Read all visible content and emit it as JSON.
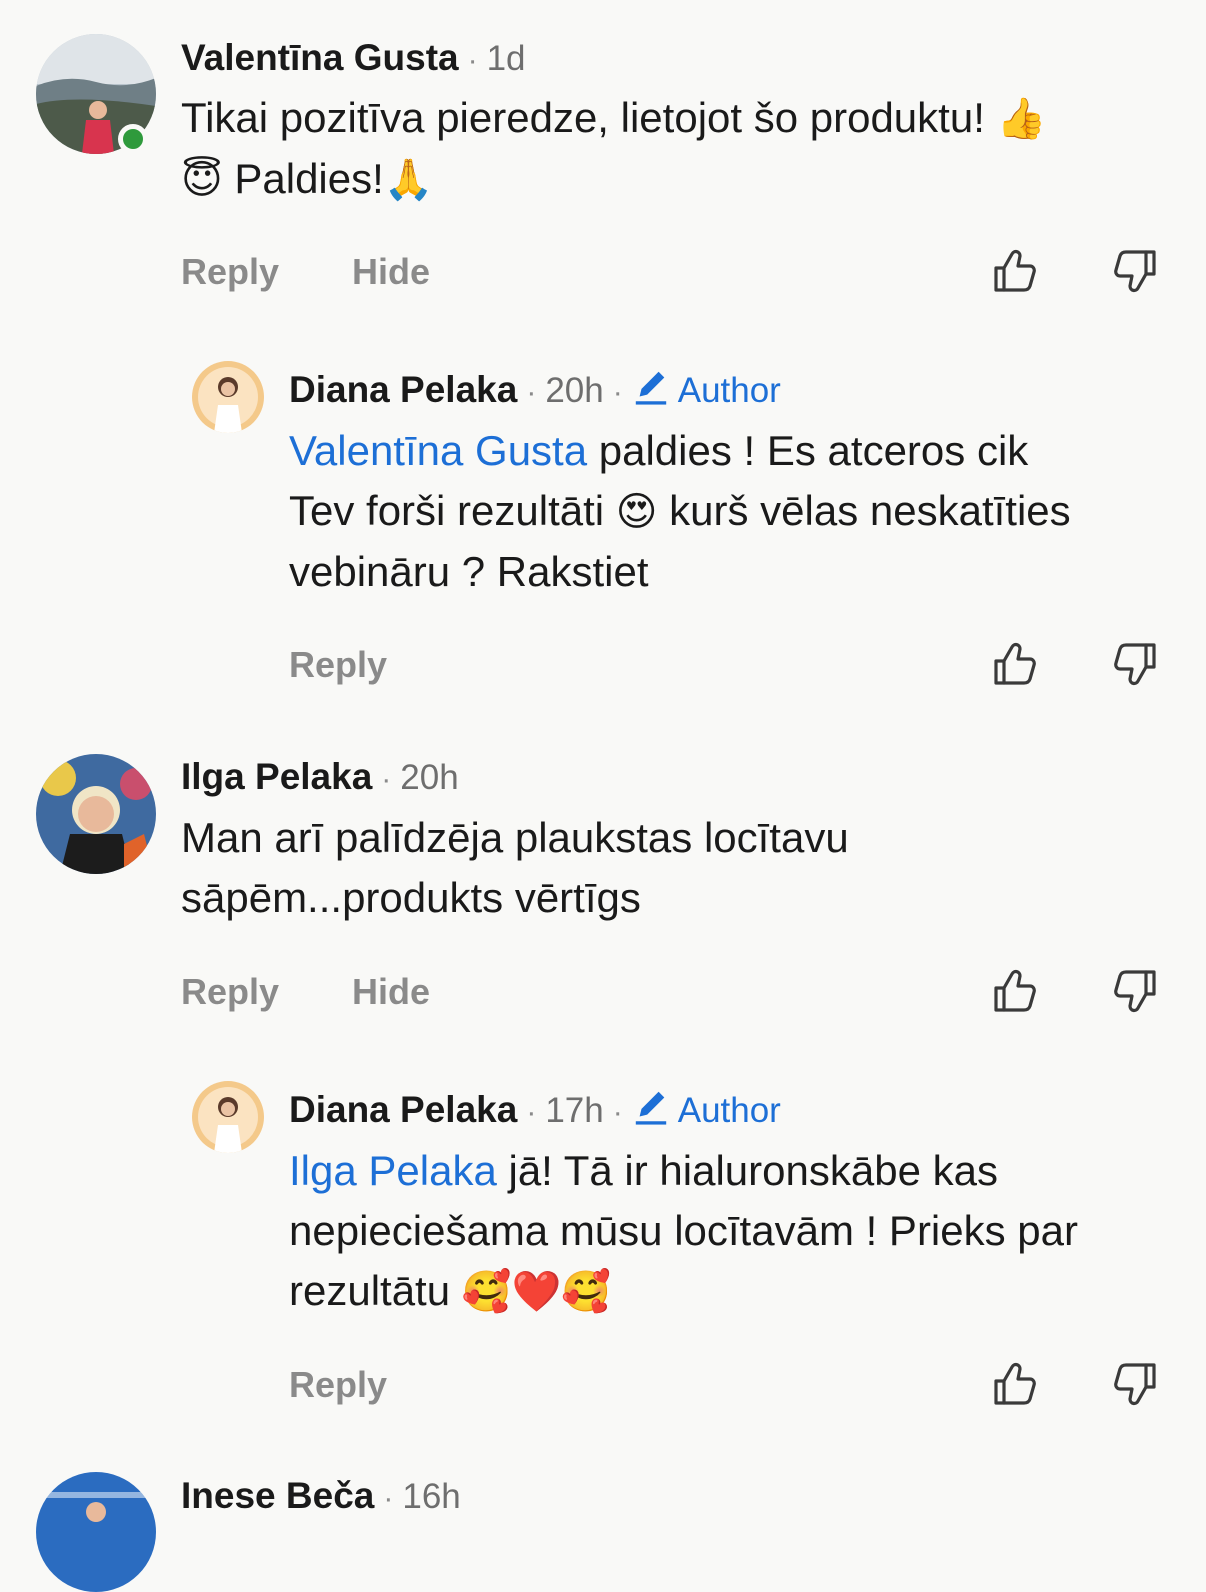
{
  "comments": [
    {
      "name": "Valentīna Gusta",
      "time": "1d",
      "text": "Tikai pozitīva pieredze, lietojot šo produktu! 👍 😇 Paldies!🙏",
      "line1": "Tikai pozitīva pieredze, lietojot šo produktu! ",
      "emoji1": "👍",
      "line2emoji": "😇",
      "line2": " Paldies!",
      "emoji2": "🙏",
      "reply_label": "Reply",
      "hide_label": "Hide"
    },
    {
      "name": "Diana Pelaka",
      "time": "20h",
      "badge": "Author",
      "mention": "Valentīna Gusta",
      "text_a": " paldies ! Es atceros cik",
      "text_b": "Tev forši rezultāti ",
      "emoji": "😍",
      "text_c": " kurš vēlas neskatīties",
      "text_d": "vebināru ? Rakstiet",
      "reply_label": "Reply"
    },
    {
      "name": "Ilga Pelaka",
      "time": "20h",
      "line1": "Man arī palīdzēja plaukstas locītavu",
      "line2": "sāpēm...produkts vērtīgs",
      "reply_label": "Reply",
      "hide_label": "Hide"
    },
    {
      "name": "Diana Pelaka",
      "time": "17h",
      "badge": "Author",
      "mention": "Ilga Pelaka",
      "text_a": " jā! Tā ir hialuronskābe kas",
      "text_b": "nepieciešama mūsu locītavām ! Prieks par",
      "text_c": "rezultātu ",
      "emojis": "🥰❤️🥰",
      "reply_label": "Reply"
    },
    {
      "name": "Inese Beča",
      "time": "16h"
    }
  ],
  "colors": {
    "accent": "#1d6fd6",
    "online": "#2f9a3c",
    "muted": "#8a8a8a",
    "background": "#f9f9f7"
  },
  "icons": [
    "thumbs-up-icon",
    "thumbs-down-icon",
    "pencil-icon"
  ]
}
